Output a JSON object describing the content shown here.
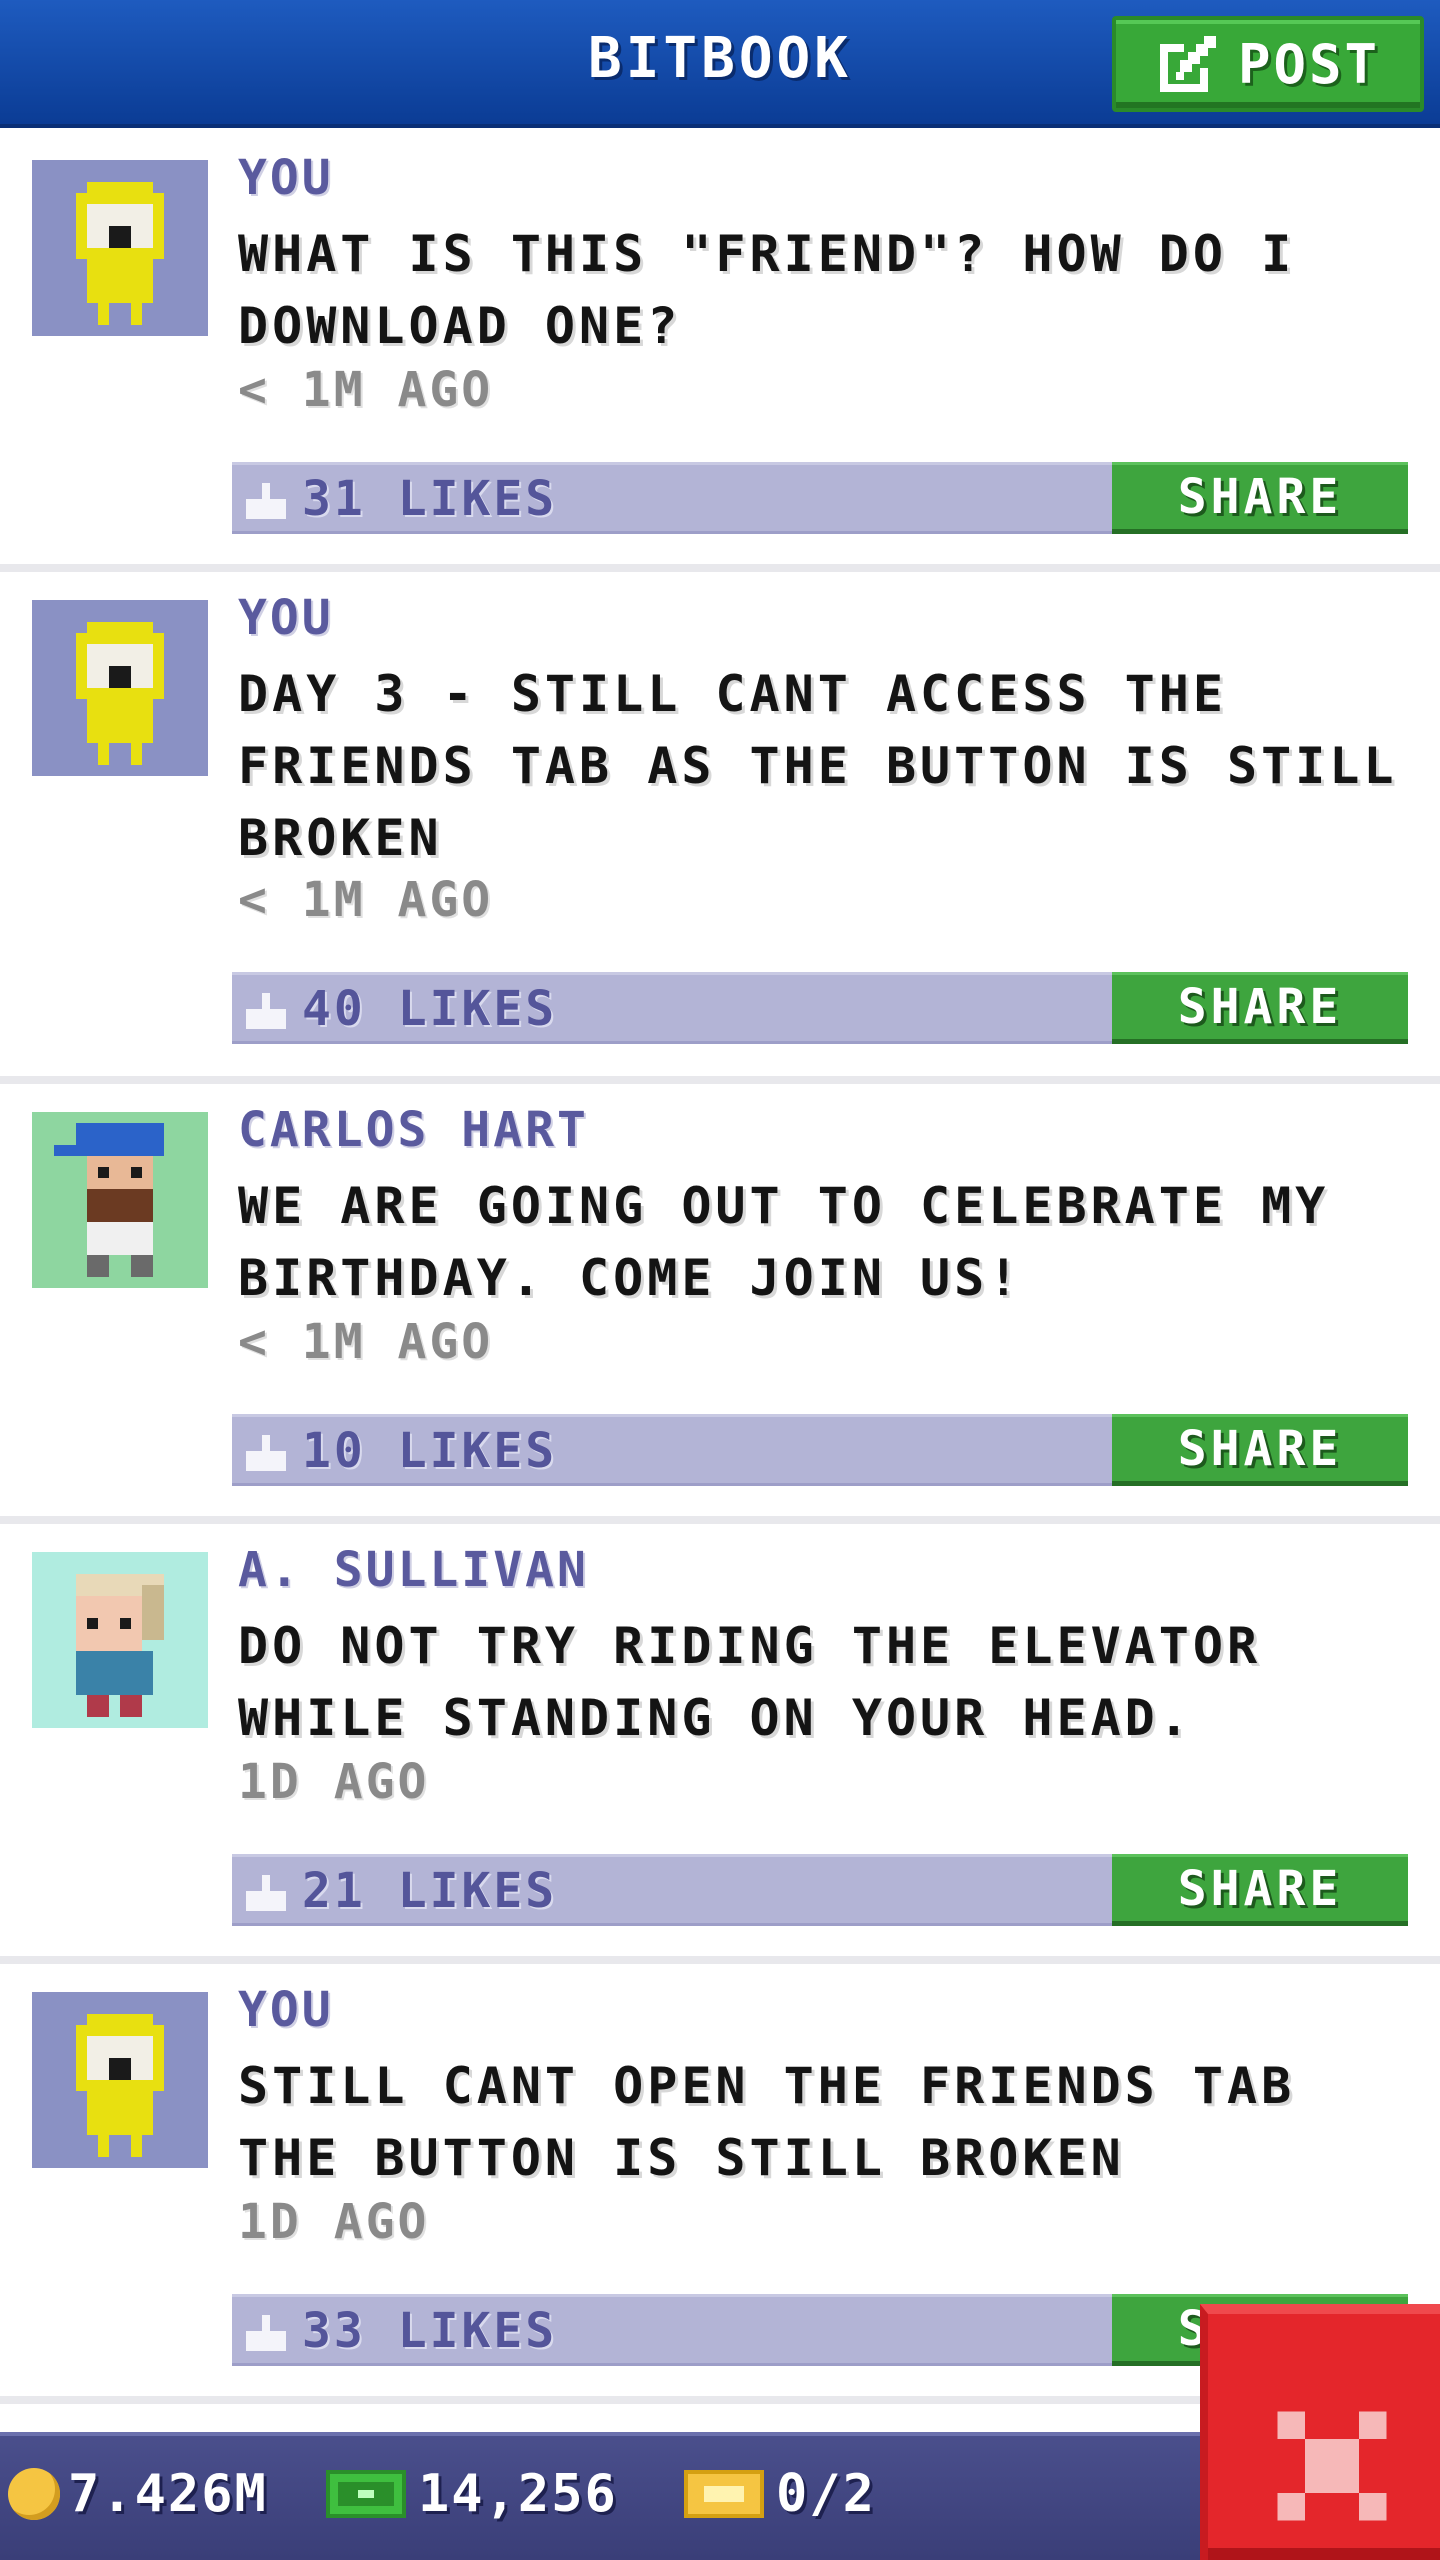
{
  "header": {
    "title": "BITBOOK",
    "post_label": "POST"
  },
  "posts": [
    {
      "author": "YOU",
      "avatar": "yellow-hooded-character-icon",
      "text": "WHAT IS THIS \"FRIEND\"? HOW DO I DOWNLOAD ONE?",
      "time": "< 1M AGO",
      "likes": "31 LIKES",
      "share": "SHARE"
    },
    {
      "author": "YOU",
      "avatar": "yellow-hooded-character-icon",
      "text": "DAY 3 - STILL CANT ACCESS THE FRIENDS TAB AS THE BUTTON IS STILL BROKEN",
      "time": "< 1M AGO",
      "likes": "40 LIKES",
      "share": "SHARE"
    },
    {
      "author": "CARLOS HART",
      "avatar": "bearded-man-blue-cap-icon",
      "text": "WE ARE GOING OUT TO CELEBRATE MY BIRTHDAY. COME JOIN US!",
      "time": "< 1M AGO",
      "likes": "10 LIKES",
      "share": "SHARE"
    },
    {
      "author": "A. SULLIVAN",
      "avatar": "blond-man-avatar-icon",
      "text": "DO NOT TRY RIDING THE ELEVATOR WHILE STANDING ON YOUR HEAD.",
      "time": "1D AGO",
      "likes": "21 LIKES",
      "share": "SHARE"
    },
    {
      "author": "YOU",
      "avatar": "yellow-hooded-character-icon",
      "text": "STILL CANT OPEN THE FRIENDS TAB THE BUTTON IS STILL BROKEN",
      "time": "1D AGO",
      "likes": "33 LIKES",
      "share": "SHARE"
    }
  ],
  "footer": {
    "coins": "7.426M",
    "bux": "14,256",
    "tickets": "0/2"
  },
  "colors": {
    "header": "#1b55b8",
    "accent_green": "#3ea53e",
    "likes_bar": "#b3b4d6",
    "close_red": "#e4262b"
  }
}
